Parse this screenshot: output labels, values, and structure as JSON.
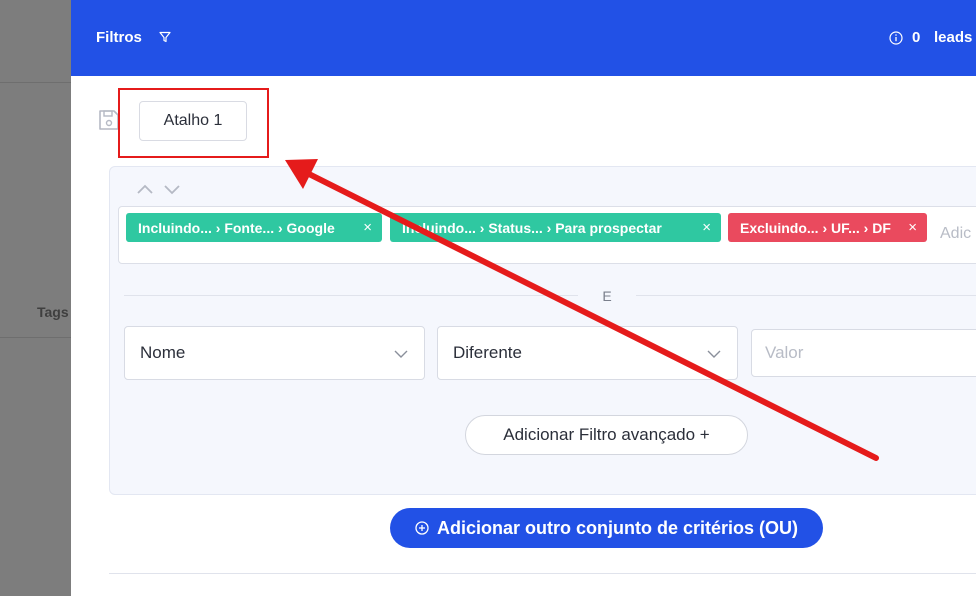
{
  "background": {
    "tags_label": "Tags"
  },
  "header": {
    "title": "Filtros",
    "lead_count": "0",
    "leads_label": "leads"
  },
  "shortcut": {
    "label": "Atalho 1"
  },
  "criteria": {
    "chips": [
      {
        "text": "Incluindo... › Fonte... › Google",
        "type": "include"
      },
      {
        "text": "Incluindo... › Status... › Para prospectar",
        "type": "include"
      },
      {
        "text": "Excluindo... › UF... › DF",
        "type": "exclude"
      }
    ],
    "chip_close": "×",
    "tags_placeholder": "Adic",
    "and_label": "E",
    "field_select": "Nome",
    "operator_select": "Diferente",
    "value_placeholder": "Valor",
    "advanced_button": "Adicionar Filtro avançado +"
  },
  "actions": {
    "add_or_button": "Adicionar outro conjunto de critérios (OU)"
  },
  "colors": {
    "header_blue": "#2251e6",
    "chip_green": "#2fc8a1",
    "chip_red": "#ea4a5e",
    "annotation_red": "#e51b1b"
  },
  "icons": [
    "filter-icon",
    "info-icon",
    "save-icon",
    "chevron-up-icon",
    "chevron-down-icon",
    "close-icon",
    "plus-circle-icon"
  ]
}
